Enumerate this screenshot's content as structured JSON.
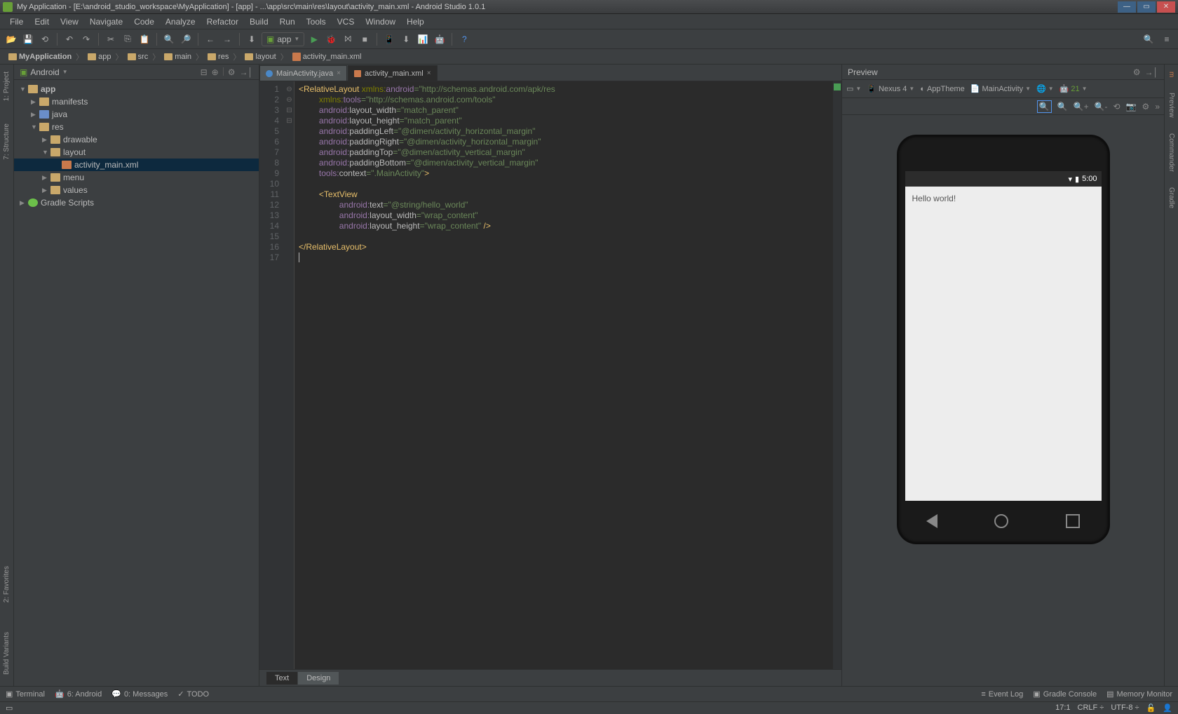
{
  "titlebar": {
    "text": "My Application - [E:\\android_studio_workspace\\MyApplication] - [app] - ...\\app\\src\\main\\res\\layout\\activity_main.xml - Android Studio 1.0.1"
  },
  "menu": [
    "File",
    "Edit",
    "View",
    "Navigate",
    "Code",
    "Analyze",
    "Refactor",
    "Build",
    "Run",
    "Tools",
    "VCS",
    "Window",
    "Help"
  ],
  "toolbar": {
    "run_config": "app"
  },
  "breadcrumb": [
    "MyApplication",
    "app",
    "src",
    "main",
    "res",
    "layout",
    "activity_main.xml"
  ],
  "project": {
    "selector": "Android",
    "tree": {
      "app": "app",
      "manifests": "manifests",
      "java": "java",
      "res": "res",
      "drawable": "drawable",
      "layout": "layout",
      "activity_main": "activity_main.xml",
      "menu": "menu",
      "values": "values",
      "gradle": "Gradle Scripts"
    }
  },
  "editor": {
    "tabs": [
      {
        "label": "MainActivity.java",
        "icon": "java"
      },
      {
        "label": "activity_main.xml",
        "icon": "xml",
        "active": true
      }
    ],
    "lines": [
      "1",
      "2",
      "3",
      "4",
      "5",
      "6",
      "7",
      "8",
      "9",
      "10",
      "11",
      "12",
      "13",
      "14",
      "15",
      "16",
      "17"
    ],
    "code": {
      "l1a": "<RelativeLayout ",
      "l1b": "xmlns:",
      "l1c": "android",
      "l1d": "=\"http://schemas.android.com/apk/res",
      "l2a": "xmlns:",
      "l2b": "tools",
      "l2c": "=\"http://schemas.android.com/tools\"",
      "l3a": "android:",
      "l3b": "layout_width",
      "l3c": "=\"match_parent\"",
      "l4a": "android:",
      "l4b": "layout_height",
      "l4c": "=\"match_parent\"",
      "l5a": "android:",
      "l5b": "paddingLeft",
      "l5c": "=\"@dimen/activity_horizontal_margin\"",
      "l6a": "android:",
      "l6b": "paddingRight",
      "l6c": "=\"@dimen/activity_horizontal_margin\"",
      "l7a": "android:",
      "l7b": "paddingTop",
      "l7c": "=\"@dimen/activity_vertical_margin\"",
      "l8a": "android:",
      "l8b": "paddingBottom",
      "l8c": "=\"@dimen/activity_vertical_margin\"",
      "l9a": "tools:",
      "l9b": "context",
      "l9c": "=\".MainActivity\"",
      "l9d": ">",
      "l11": "<TextView",
      "l12a": "android:",
      "l12b": "text",
      "l12c": "=\"@string/hello_world\"",
      "l13a": "android:",
      "l13b": "layout_width",
      "l13c": "=\"wrap_content\"",
      "l14a": "android:",
      "l14b": "layout_height",
      "l14c": "=\"wrap_content\" ",
      "l14d": "/>",
      "l16": "</RelativeLayout>"
    },
    "bottom_tabs": {
      "text": "Text",
      "design": "Design"
    }
  },
  "preview": {
    "title": "Preview",
    "device": "Nexus 4",
    "theme": "AppTheme",
    "activity": "MainActivity",
    "api": "21",
    "status_time": "5:00",
    "hello": "Hello world!"
  },
  "left_gutter": {
    "project": "1: Project",
    "structure": "7: Structure",
    "favorites": "2: Favorites",
    "build": "Build Variants"
  },
  "right_gutter": {
    "maven": "Maven Projects",
    "preview": "Preview",
    "commander": "Commander",
    "gradle": "Gradle"
  },
  "bottom_tools": {
    "terminal": "Terminal",
    "android": "6: Android",
    "messages": "0: Messages",
    "todo": "TODO",
    "eventlog": "Event Log",
    "gradle": "Gradle Console",
    "memory": "Memory Monitor"
  },
  "status": {
    "pos": "17:1",
    "sep": "CRLF",
    "enc": "UTF-8"
  }
}
